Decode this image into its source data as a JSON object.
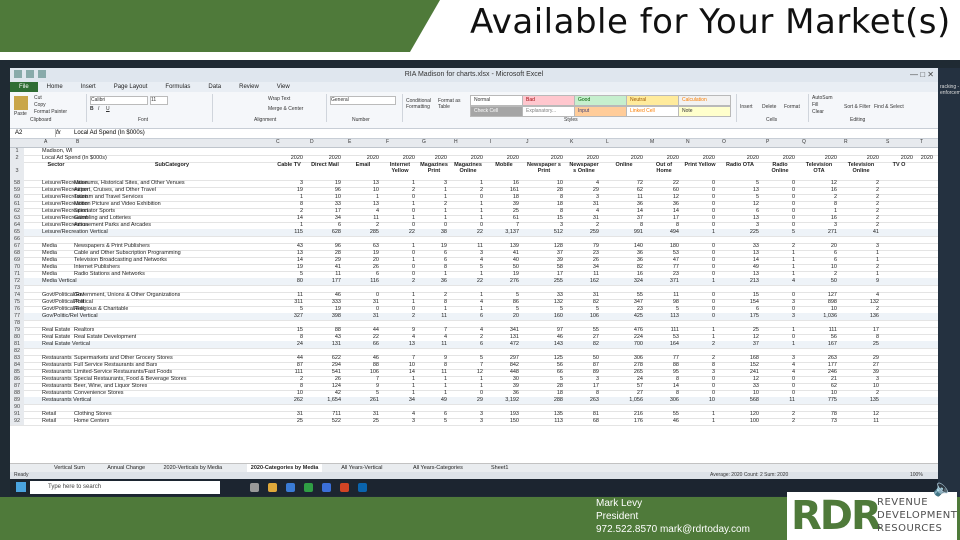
{
  "slide": {
    "title": "Available for Your Market(s)",
    "contact_name": "Mark Levy",
    "contact_title": "President",
    "contact_details": "972.522.8570 mark@rdrtoday.com",
    "logo_initials": "RDR",
    "logo_line1": "REVENUE",
    "logo_line2": "DEVELOPMENT",
    "logo_line3": "RESOURCES",
    "side_text": "racking - enforcement",
    "colors": {
      "green": "#4f7a3a",
      "dark": "#1f2a33"
    }
  },
  "excel": {
    "window_title": "RIA Madison for charts.xlsx - Microsoft Excel",
    "menu": [
      "File",
      "Home",
      "Insert",
      "Page Layout",
      "Formulas",
      "Data",
      "Review",
      "View"
    ],
    "ribbon": {
      "paste": "Paste",
      "cut": "Cut",
      "copy": "Copy",
      "format_painter": "Format Painter",
      "clipboard": "Clipboard",
      "font_name": "Calibri",
      "font_size": "11",
      "font": "Font",
      "wrap_text": "Wrap Text",
      "merge_center": "Merge & Center",
      "alignment": "Alignment",
      "number_format": "General",
      "number": "Number",
      "conditional_formatting": "Conditional Formatting",
      "format_as_table": "Format as Table",
      "styles_label": "Styles",
      "styles": [
        "Normal",
        "Bad",
        "Good",
        "Neutral",
        "Calculation",
        "Check Cell",
        "Explanatory...",
        "Input",
        "Linked Cell",
        "Note"
      ],
      "insert": "Insert",
      "delete": "Delete",
      "format": "Format",
      "cells": "Cells",
      "autosum": "AutoSum",
      "fill": "Fill",
      "clear": "Clear",
      "sort_filter": "Sort & Filter",
      "find_select": "Find & Select",
      "editing": "Editing"
    },
    "name_box": "A2",
    "formula": "Local Ad Spend (In $000s)",
    "columns": [
      "A",
      "B",
      "C",
      "D",
      "E",
      "F",
      "G",
      "H",
      "I",
      "J",
      "K",
      "L",
      "M",
      "N",
      "O",
      "P",
      "Q",
      "R",
      "S",
      "T"
    ],
    "header_rows": [
      {
        "num": "1",
        "cells": [
          "Madison, WI"
        ]
      },
      {
        "num": "2",
        "cells": [
          "Local Ad Spend (In $000s)",
          "",
          "2020",
          "2020",
          "2020",
          "2020",
          "2020",
          "2020",
          "2020",
          "2020",
          "2020",
          "2020",
          "2020",
          "2020",
          "2020",
          "2020",
          "2020",
          "2020",
          "2020",
          "2020"
        ]
      },
      {
        "num": "3",
        "cells": [
          "Sector",
          "SubCategory",
          "Cable TV",
          "Direct Mail",
          "Email",
          "Internet Yellow",
          "Magazines Print",
          "Magazines Online",
          "Mobile",
          "Newspaper s Print",
          "Newspaper s Online",
          "Online",
          "Out of Home",
          "Print Yellow",
          "Radio OTA",
          "Radio Online",
          "Television OTA",
          "Television Online",
          "TV O"
        ]
      }
    ],
    "rows": [
      {
        "num": "58",
        "cells": [
          "Leisure/Recreation",
          "Museums, Historical Sites, and Other Venues",
          "3",
          "19",
          "13",
          "1",
          "3",
          "1",
          "16",
          "10",
          "4",
          "72",
          "22",
          "0",
          "5",
          "0",
          "12",
          "2"
        ]
      },
      {
        "num": "59",
        "cells": [
          "Leisure/Recreation",
          "Airport, Cruises, and Other Travel",
          "19",
          "96",
          "10",
          "2",
          "1",
          "2",
          "161",
          "28",
          "29",
          "62",
          "60",
          "0",
          "13",
          "0",
          "16",
          "2"
        ]
      },
      {
        "num": "60",
        "cells": [
          "Leisure/Recreation",
          "Tourism and Travel Services",
          "1",
          "10",
          "1",
          "0",
          "1",
          "0",
          "18",
          "8",
          "3",
          "11",
          "12",
          "0",
          "5",
          "0",
          "2",
          "2"
        ]
      },
      {
        "num": "61",
        "cells": [
          "Leisure/Recreation",
          "Motion Picture and Video Exhibition",
          "8",
          "33",
          "13",
          "1",
          "2",
          "1",
          "39",
          "18",
          "31",
          "36",
          "36",
          "0",
          "12",
          "0",
          "8",
          "2"
        ]
      },
      {
        "num": "62",
        "cells": [
          "Leisure/Recreation",
          "Spectator Sports",
          "2",
          "17",
          "4",
          "0",
          "1",
          "1",
          "25",
          "8",
          "4",
          "14",
          "14",
          "0",
          "6",
          "0",
          "1",
          "2"
        ]
      },
      {
        "num": "63",
        "cells": [
          "Leisure/Recreation",
          "Gambling and Lotteries",
          "14",
          "34",
          "11",
          "1",
          "1",
          "1",
          "61",
          "15",
          "31",
          "37",
          "17",
          "0",
          "13",
          "0",
          "16",
          "2"
        ]
      },
      {
        "num": "64",
        "cells": [
          "Leisure/Recreation",
          "Amusement Parks and Arcades",
          "1",
          "6",
          "2",
          "0",
          "0",
          "0",
          "7",
          "3",
          "2",
          "8",
          "8",
          "0",
          "3",
          "0",
          "3",
          "2"
        ]
      },
      {
        "num": "65",
        "cells": [
          "Leisure/Recreation Vertical",
          "",
          "115",
          "628",
          "285",
          "22",
          "38",
          "22",
          "3,137",
          "512",
          "259",
          "991",
          "494",
          "1",
          "225",
          "5",
          "271",
          "41"
        ]
      },
      {
        "num": "66",
        "cells": [
          "",
          "",
          "",
          "",
          "",
          "",
          "",
          "",
          "",
          "",
          "",
          "",
          "",
          "",
          "",
          "",
          "",
          ""
        ]
      },
      {
        "num": "67",
        "cells": [
          "Media",
          "Newspapers & Print Publishers",
          "43",
          "96",
          "63",
          "1",
          "19",
          "11",
          "139",
          "128",
          "79",
          "140",
          "180",
          "0",
          "33",
          "2",
          "20",
          "3"
        ]
      },
      {
        "num": "68",
        "cells": [
          "Media",
          "Cable and Other Subscription Programming",
          "13",
          "28",
          "19",
          "0",
          "6",
          "3",
          "41",
          "37",
          "23",
          "36",
          "53",
          "0",
          "13",
          "1",
          "6",
          "1"
        ]
      },
      {
        "num": "69",
        "cells": [
          "Media",
          "Television Broadcasting and Networks",
          "14",
          "29",
          "20",
          "1",
          "6",
          "4",
          "40",
          "39",
          "26",
          "36",
          "47",
          "0",
          "14",
          "1",
          "6",
          "1"
        ]
      },
      {
        "num": "70",
        "cells": [
          "Media",
          "Internet Publishers",
          "19",
          "41",
          "26",
          "0",
          "8",
          "5",
          "50",
          "58",
          "34",
          "82",
          "77",
          "0",
          "49",
          "1",
          "10",
          "2"
        ]
      },
      {
        "num": "71",
        "cells": [
          "Media",
          "Radio Stations and Networks",
          "5",
          "11",
          "6",
          "0",
          "1",
          "1",
          "19",
          "17",
          "11",
          "16",
          "23",
          "0",
          "13",
          "1",
          "2",
          "1"
        ]
      },
      {
        "num": "72",
        "cells": [
          "Media Vertical",
          "",
          "80",
          "177",
          "116",
          "2",
          "36",
          "22",
          "276",
          "255",
          "162",
          "324",
          "371",
          "1",
          "213",
          "4",
          "50",
          "9"
        ]
      },
      {
        "num": "73",
        "cells": [
          "",
          "",
          "",
          "",
          "",
          "",
          "",
          "",
          "",
          "",
          "",
          "",
          "",
          "",
          "",
          "",
          "",
          ""
        ]
      },
      {
        "num": "74",
        "cells": [
          "Govt/Political/Rel",
          "Government, Unions & Other Organizations",
          "11",
          "46",
          "0",
          "1",
          "2",
          "1",
          "5",
          "33",
          "31",
          "55",
          "11",
          "0",
          "15",
          "0",
          "127",
          "4"
        ]
      },
      {
        "num": "75",
        "cells": [
          "Govt/Political/Rel",
          "Political",
          "311",
          "333",
          "31",
          "1",
          "8",
          "4",
          "86",
          "132",
          "82",
          "347",
          "98",
          "0",
          "154",
          "3",
          "898",
          "132"
        ]
      },
      {
        "num": "76",
        "cells": [
          "Govt/Political/Rel",
          "Religious & Charitable",
          "5",
          "19",
          "0",
          "0",
          "1",
          "1",
          "5",
          "5",
          "5",
          "23",
          "5",
          "0",
          "6",
          "0",
          "10",
          "2"
        ]
      },
      {
        "num": "77",
        "cells": [
          "Gov/Politic/Rel Vertical",
          "",
          "327",
          "398",
          "31",
          "2",
          "11",
          "6",
          "20",
          "160",
          "106",
          "425",
          "113",
          "0",
          "175",
          "3",
          "1,036",
          "136"
        ]
      },
      {
        "num": "78",
        "cells": [
          "",
          "",
          "",
          "",
          "",
          "",
          "",
          "",
          "",
          "",
          "",
          "",
          "",
          "",
          "",
          "",
          "",
          ""
        ]
      },
      {
        "num": "79",
        "cells": [
          "Real Estate",
          "Realtors",
          "15",
          "88",
          "44",
          "9",
          "7",
          "4",
          "341",
          "97",
          "55",
          "476",
          "111",
          "1",
          "25",
          "1",
          "111",
          "17"
        ]
      },
      {
        "num": "80",
        "cells": [
          "Real Estate",
          "Real Estate Development",
          "8",
          "43",
          "22",
          "4",
          "4",
          "2",
          "131",
          "46",
          "27",
          "224",
          "53",
          "1",
          "12",
          "0",
          "56",
          "8"
        ]
      },
      {
        "num": "81",
        "cells": [
          "Real Estate Vertical",
          "",
          "24",
          "131",
          "66",
          "13",
          "11",
          "6",
          "472",
          "143",
          "82",
          "700",
          "164",
          "2",
          "37",
          "1",
          "167",
          "25"
        ]
      },
      {
        "num": "82",
        "cells": [
          "",
          "",
          "",
          "",
          "",
          "",
          "",
          "",
          "",
          "",
          "",
          "",
          "",
          "",
          "",
          "",
          "",
          ""
        ]
      },
      {
        "num": "83",
        "cells": [
          "Restaurants",
          "Supermarkets and Other Grocery Stores",
          "44",
          "622",
          "46",
          "7",
          "9",
          "5",
          "297",
          "125",
          "50",
          "306",
          "77",
          "2",
          "168",
          "3",
          "263",
          "29"
        ]
      },
      {
        "num": "84",
        "cells": [
          "Restaurants",
          "Full Service Restaurants and Bars",
          "87",
          "294",
          "88",
          "10",
          "8",
          "7",
          "842",
          "56",
          "87",
          "278",
          "88",
          "8",
          "152",
          "4",
          "177",
          "27"
        ]
      },
      {
        "num": "85",
        "cells": [
          "Restaurants",
          "Limited-Service Restaurants/Fast Foods",
          "111",
          "541",
          "106",
          "14",
          "11",
          "12",
          "448",
          "66",
          "89",
          "265",
          "95",
          "3",
          "241",
          "4",
          "246",
          "39"
        ]
      },
      {
        "num": "86",
        "cells": [
          "Restaurants",
          "Special Restaurants, Food & Beverage Stores",
          "2",
          "26",
          "7",
          "1",
          "1",
          "1",
          "30",
          "5",
          "3",
          "24",
          "8",
          "0",
          "12",
          "0",
          "21",
          "3"
        ]
      },
      {
        "num": "87",
        "cells": [
          "Restaurants",
          "Beer, Wine, and Liquor Stores",
          "8",
          "124",
          "9",
          "1",
          "1",
          "1",
          "39",
          "28",
          "17",
          "57",
          "14",
          "0",
          "33",
          "0",
          "62",
          "10"
        ]
      },
      {
        "num": "88",
        "cells": [
          "Restaurants",
          "Convenience Stores",
          "10",
          "42",
          "5",
          "1",
          "1",
          "0",
          "36",
          "18",
          "8",
          "27",
          "8",
          "0",
          "10",
          "0",
          "10",
          "2"
        ]
      },
      {
        "num": "89",
        "cells": [
          "Restaurants Vertical",
          "",
          "262",
          "1,654",
          "261",
          "34",
          "49",
          "29",
          "3,192",
          "288",
          "263",
          "1,056",
          "306",
          "10",
          "568",
          "11",
          "775",
          "135"
        ]
      },
      {
        "num": "90",
        "cells": [
          "",
          "",
          "",
          "",
          "",
          "",
          "",
          "",
          "",
          "",
          "",
          "",
          "",
          "",
          "",
          "",
          "",
          ""
        ]
      },
      {
        "num": "91",
        "cells": [
          "Retail",
          "Clothing Stores",
          "31",
          "711",
          "31",
          "4",
          "6",
          "3",
          "193",
          "135",
          "81",
          "216",
          "55",
          "1",
          "120",
          "2",
          "78",
          "12"
        ]
      },
      {
        "num": "92",
        "cells": [
          "Retail",
          "Home Centers",
          "25",
          "522",
          "25",
          "3",
          "5",
          "3",
          "150",
          "113",
          "68",
          "176",
          "46",
          "1",
          "100",
          "2",
          "73",
          "11"
        ]
      }
    ],
    "sheets": [
      "Vertical Sum",
      "Annual Change",
      "2020-Verticals by Media",
      "2020-Categories by Media",
      "All Years-Vertical",
      "All Years-Categories",
      "Sheet1"
    ],
    "active_sheet": "2020-Categories by Media",
    "status_ready": "Ready",
    "status_stats": "Average: 2020    Count: 2    Sum: 2020",
    "zoom": "100%",
    "taskbar_search": "Type here to search"
  }
}
